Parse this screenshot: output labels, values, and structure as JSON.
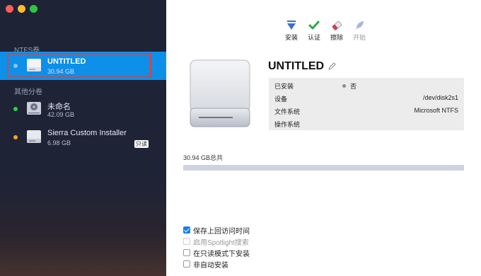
{
  "colors": {
    "sidebar_bg": "#1e2336",
    "selected_bg": "#0e8fe8",
    "selection_outline": "#e0403f",
    "mounted_dot": "#2bd14a",
    "orange_dot": "#f5a623",
    "accent": "#1a7ff0"
  },
  "sidebar": {
    "ntfs_section": "NTFS卷",
    "other_section": "其他分卷",
    "ntfs_items": [
      {
        "name": "UNTITLED",
        "size": "30.94 GB",
        "icon": "external-drive-icon"
      }
    ],
    "other_items": [
      {
        "name": "未命名",
        "size": "42.09 GB",
        "icon": "internal-drive-icon",
        "status": "green"
      },
      {
        "name": "Sierra Custom Installer",
        "size": "6.98 GB",
        "icon": "external-drive-icon",
        "status": "orange",
        "badge": "只读"
      }
    ]
  },
  "toolbar": {
    "mount": {
      "label": "安装",
      "icon": "mount-icon"
    },
    "verify": {
      "label": "认证",
      "icon": "checkmark-icon"
    },
    "erase": {
      "label": "擦除",
      "icon": "eraser-icon"
    },
    "start": {
      "label": "开始",
      "icon": "rocket-icon"
    }
  },
  "detail": {
    "volume_name": "UNTITLED",
    "rows": [
      {
        "label": "已安装",
        "value": "否"
      },
      {
        "label": "设备",
        "value": "/dev/disk2s1"
      },
      {
        "label": "文件系统",
        "value": "Microsoft NTFS"
      },
      {
        "label": "操作系统",
        "value": ""
      }
    ],
    "total_label": "30.94 GB总共",
    "usage_fraction": 0
  },
  "options": [
    {
      "label": "保存上回访问时间",
      "checked": true,
      "enabled": true
    },
    {
      "label": "启用Spotlight搜索",
      "checked": false,
      "enabled": false
    },
    {
      "label": "在只读模式下安装",
      "checked": false,
      "enabled": true
    },
    {
      "label": "非自动安装",
      "checked": false,
      "enabled": true
    }
  ]
}
